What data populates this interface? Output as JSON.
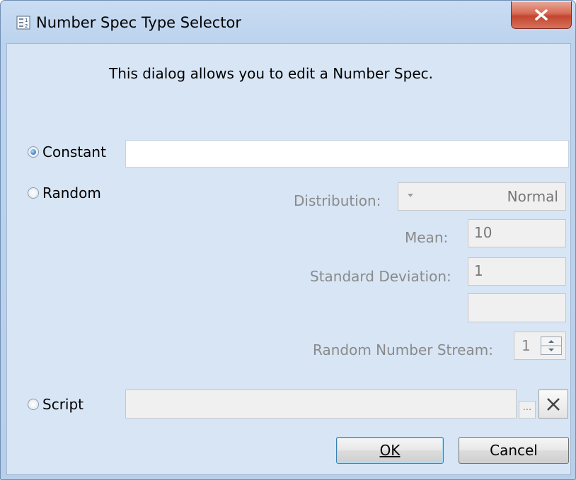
{
  "window": {
    "title": "Number Spec Type Selector",
    "close_icon": "close-icon"
  },
  "dialog": {
    "description": "This dialog allows you to edit a Number Spec."
  },
  "constant": {
    "label": "Constant",
    "selected": true,
    "value": ""
  },
  "random": {
    "label": "Random",
    "selected": false,
    "distribution_label": "Distribution:",
    "distribution_value": "Normal",
    "mean_label": "Mean:",
    "mean_value": "10",
    "std_label": "Standard Deviation:",
    "std_value": "1",
    "extra_value": "",
    "stream_label": "Random Number Stream:",
    "stream_value": "1"
  },
  "script": {
    "label": "Script",
    "selected": false,
    "value": "",
    "browse_label": "..."
  },
  "buttons": {
    "ok_label": "OK",
    "cancel_label": "Cancel"
  }
}
